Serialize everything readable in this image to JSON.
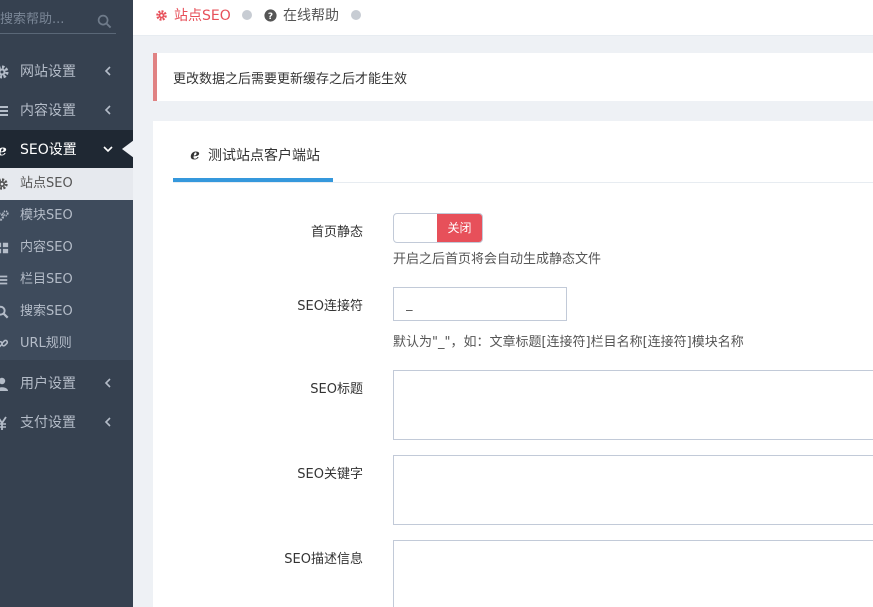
{
  "sidebar": {
    "search_placeholder": "搜索帮助...",
    "menu": [
      {
        "label": "网站设置",
        "icon": "gear-icon"
      },
      {
        "label": "内容设置",
        "icon": "list-icon"
      },
      {
        "label": "SEO设置",
        "icon": "ie-icon",
        "active": true
      }
    ],
    "submenu": [
      {
        "label": "站点SEO",
        "icon": "gear-icon",
        "current": true
      },
      {
        "label": "模块SEO",
        "icon": "cogs-icon"
      },
      {
        "label": "内容SEO",
        "icon": "grid-icon"
      },
      {
        "label": "栏目SEO",
        "icon": "list-icon"
      },
      {
        "label": "搜索SEO",
        "icon": "search-icon"
      },
      {
        "label": "URL规则",
        "icon": "link-icon"
      }
    ],
    "menu_rest": [
      {
        "label": "用户设置",
        "icon": "user-icon"
      },
      {
        "label": "支付设置",
        "icon": "rmb-icon"
      }
    ]
  },
  "breadcrumb": {
    "items": [
      {
        "label": "站点SEO",
        "icon": "gear-icon",
        "color": "#e7505a"
      },
      {
        "label": "在线帮助",
        "icon": "question-circle-icon",
        "color": "#555555"
      }
    ]
  },
  "alert": {
    "text": "更改数据之后需要更新缓存之后才能生效",
    "border_color": "#e08283"
  },
  "tab": {
    "label": "测试站点客户端站",
    "icon": "ie-icon"
  },
  "form": {
    "static_label": "首页静态",
    "static_toggle": "关闭",
    "static_help": "开启之后首页将会自动生成静态文件",
    "connector_label": "SEO连接符",
    "connector_value": "_",
    "connector_help": "默认为\"_\"，如：文章标题[连接符]栏目名称[连接符]模块名称",
    "title_label": "SEO标题",
    "keywords_label": "SEO关键字",
    "description_label": "SEO描述信息"
  },
  "colors": {
    "sidebar_bg": "#364150",
    "active_bg": "#1f2833",
    "tab_accent": "#3598dc",
    "toggle_off": "#e7505a"
  }
}
